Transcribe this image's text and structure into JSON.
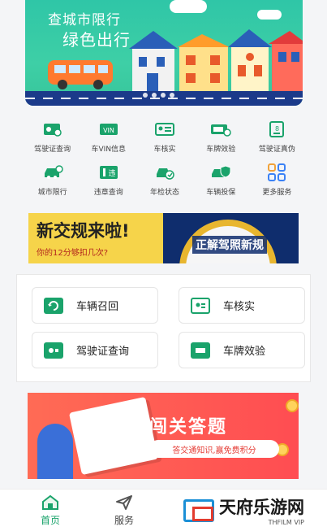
{
  "banner": {
    "title": "查城市限行",
    "subtitle": "绿色出行"
  },
  "services": [
    {
      "label": "驾驶证查询",
      "icon": "license-card-icon"
    },
    {
      "label": "车VIN信息",
      "icon": "vin-icon"
    },
    {
      "label": "车核实",
      "icon": "id-card-icon"
    },
    {
      "label": "车牌效验",
      "icon": "license-plate-icon"
    },
    {
      "label": "驾驶证真伪",
      "icon": "verify-document-icon"
    },
    {
      "label": "城市限行",
      "icon": "car-restriction-icon"
    },
    {
      "label": "违章查询",
      "icon": "violation-icon"
    },
    {
      "label": "年检状态",
      "icon": "car-check-icon"
    },
    {
      "label": "车辆投保",
      "icon": "car-insurance-icon"
    },
    {
      "label": "更多服务",
      "icon": "grid-more-icon"
    }
  ],
  "promo1": {
    "headline": "新交规来啦!",
    "sub": "你的12分够扣几次?",
    "right": "正解驾照新规"
  },
  "quick": [
    {
      "label": "车辆召回",
      "icon": "car-recall-icon"
    },
    {
      "label": "车核实",
      "icon": "id-card-icon"
    },
    {
      "label": "驾驶证查询",
      "icon": "license-card-icon"
    },
    {
      "label": "车牌效验",
      "icon": "license-plate-icon"
    }
  ],
  "promo2": {
    "headline": "闯关答题",
    "sub": "答交通知识,赢免费积分"
  },
  "nav": {
    "tabs": [
      {
        "label": "首页",
        "icon": "home-icon",
        "active": true
      },
      {
        "label": "服务",
        "icon": "send-icon",
        "active": false
      }
    ]
  },
  "watermark": {
    "title": "天府乐游网",
    "sub": "THFILM VIP"
  },
  "colors": {
    "accent": "#1aa36b",
    "banner": "#2fc6a7",
    "promo_yellow": "#f6d44a",
    "promo_red": "#ff5452"
  }
}
